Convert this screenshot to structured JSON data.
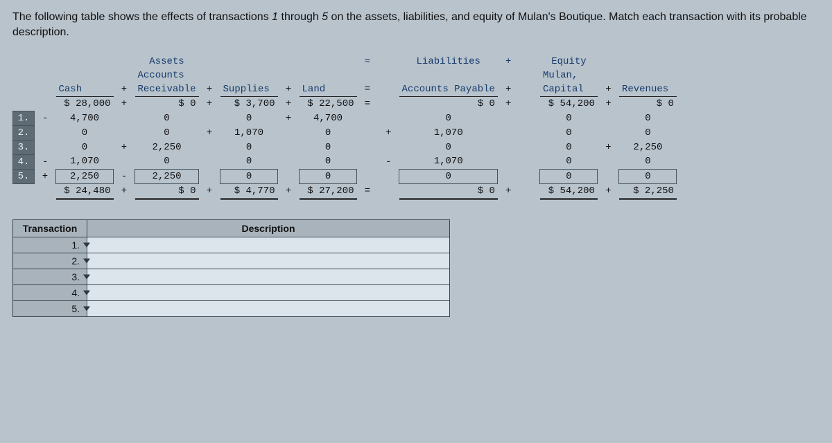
{
  "intro_html": {
    "prefix": "The following table shows the effects of transactions ",
    "ital1": "1",
    "mid": " through ",
    "ital2": "5",
    "suffix": " on the assets, liabilities, and equity of Mulan's Boutique. Match each transaction with its probable description."
  },
  "section": {
    "assets": "Assets",
    "eq_sign": "=",
    "liab": "Liabilities",
    "plus": "+",
    "equity": "Equity"
  },
  "cols": {
    "cash": "Cash",
    "ar_top": "Accounts",
    "ar_bot": "Receivable",
    "supplies": "Supplies",
    "land": "Land",
    "ap": "Accounts Payable",
    "cap_top": "Mulan,",
    "cap_bot": "Capital",
    "rev": "Revenues"
  },
  "op": {
    "p": "+",
    "m": "-",
    "e": "="
  },
  "rows": {
    "nums": [
      "1.",
      "2.",
      "3.",
      "4.",
      "5."
    ],
    "begin": {
      "cash": "$ 28,000",
      "s1": "+",
      "ar": "$ 0",
      "s2": "+",
      "sup": "$ 3,700",
      "s3": "+",
      "land": "$ 22,500",
      "s4": "=",
      "ap": "$ 0",
      "s5": "+",
      "cap": "$ 54,200",
      "s6": "+",
      "rev": "$ 0"
    },
    "r1": {
      "pre": "-",
      "cash": "4,700",
      "ar": "0",
      "sup": "0",
      "sup_s": "+",
      "land": "4,700",
      "ap": "0",
      "cap": "0",
      "rev": "0"
    },
    "r2": {
      "cash": "0",
      "ar": "0",
      "ar_s": "+",
      "sup": "1,070",
      "land": "0",
      "ap_s": "+",
      "ap": "1,070",
      "cap": "0",
      "rev": "0"
    },
    "r3": {
      "cash": "0",
      "cash_s": "+",
      "ar": "2,250",
      "sup": "0",
      "land": "0",
      "ap": "0",
      "cap": "0",
      "cap_s": "+",
      "rev": "2,250"
    },
    "r4": {
      "pre": "-",
      "cash": "1,070",
      "ar": "0",
      "sup": "0",
      "land": "0",
      "ap_s": "-",
      "ap": "1,070",
      "cap": "0",
      "rev": "0"
    },
    "r5": {
      "pre": "+",
      "cash": "2,250",
      "ar_s": "-",
      "ar": "2,250",
      "sup": "0",
      "land": "0",
      "ap": "0",
      "cap": "0",
      "rev": "0"
    },
    "end": {
      "cash": "$ 24,480",
      "s1": "+",
      "ar": "$ 0",
      "s2": "+",
      "sup": "$ 4,770",
      "s3": "+",
      "land": "$ 27,200",
      "s4": "=",
      "ap": "$ 0",
      "s5": "+",
      "cap": "$ 54,200",
      "s6": "+",
      "rev": "$ 2,250"
    }
  },
  "match": {
    "th_trans": "Transaction",
    "th_desc": "Description",
    "rows": [
      "1.",
      "2.",
      "3.",
      "4.",
      "5."
    ]
  },
  "chart_data": {
    "type": "table",
    "columns": [
      "Cash",
      "Accounts Receivable",
      "Supplies",
      "Land",
      "Accounts Payable",
      "Mulan, Capital",
      "Revenues"
    ],
    "beginning": [
      28000,
      0,
      3700,
      22500,
      0,
      54200,
      0
    ],
    "transactions": [
      {
        "n": 1,
        "Cash": -4700,
        "AccountsReceivable": 0,
        "Supplies": 0,
        "Land": 4700,
        "AccountsPayable": 0,
        "Capital": 0,
        "Revenues": 0
      },
      {
        "n": 2,
        "Cash": 0,
        "AccountsReceivable": 0,
        "Supplies": 1070,
        "Land": 0,
        "AccountsPayable": 1070,
        "Capital": 0,
        "Revenues": 0
      },
      {
        "n": 3,
        "Cash": 0,
        "AccountsReceivable": 2250,
        "Supplies": 0,
        "Land": 0,
        "AccountsPayable": 0,
        "Capital": 0,
        "Revenues": 2250
      },
      {
        "n": 4,
        "Cash": -1070,
        "AccountsReceivable": 0,
        "Supplies": 0,
        "Land": 0,
        "AccountsPayable": -1070,
        "Capital": 0,
        "Revenues": 0
      },
      {
        "n": 5,
        "Cash": 2250,
        "AccountsReceivable": -2250,
        "Supplies": 0,
        "Land": 0,
        "AccountsPayable": 0,
        "Capital": 0,
        "Revenues": 0
      }
    ],
    "ending": [
      24480,
      0,
      4770,
      27200,
      0,
      54200,
      2250
    ]
  }
}
